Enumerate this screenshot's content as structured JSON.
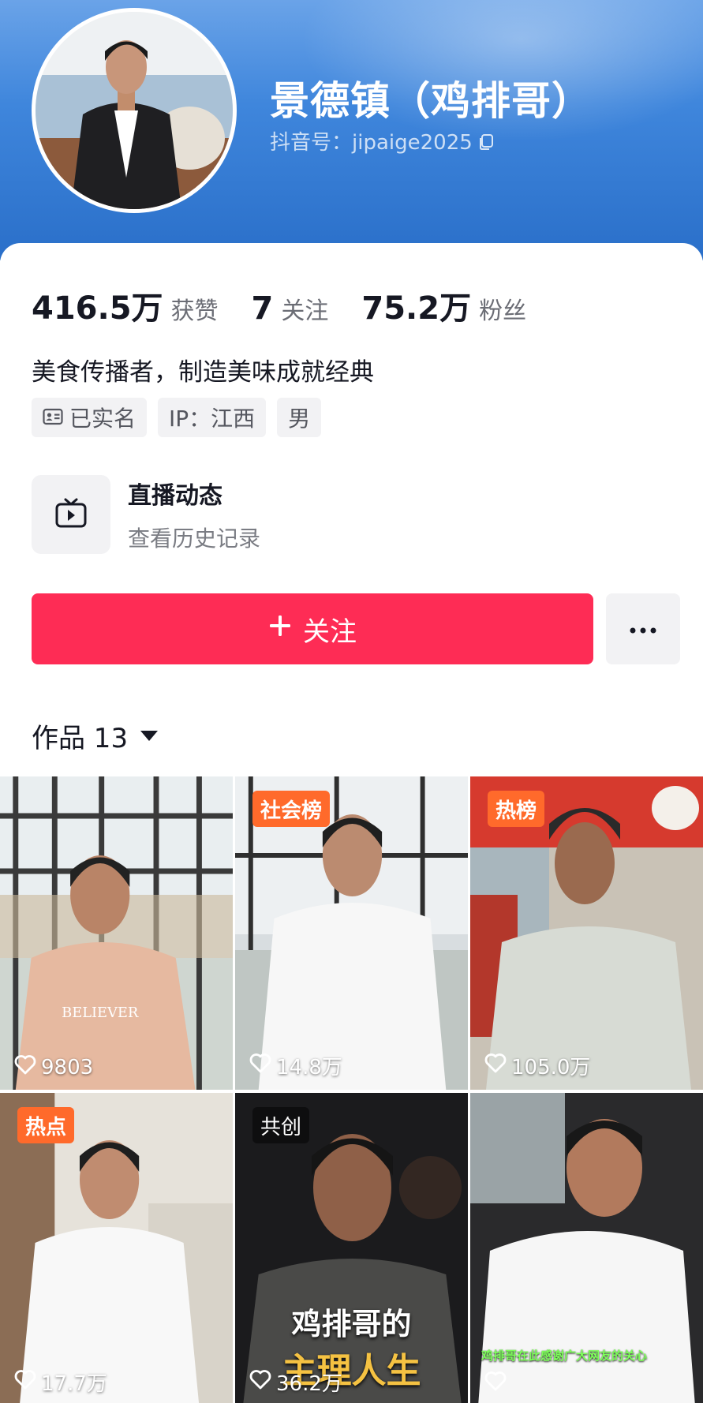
{
  "profile": {
    "nickname": "景德镇（鸡排哥）",
    "douyin_id": "抖音号：jipaige2025",
    "bio": "美食传播者，制造美味成就经典"
  },
  "stats": [
    {
      "value": "416.5万",
      "label": "获赞"
    },
    {
      "value": "7",
      "label": "关注"
    },
    {
      "value": "75.2万",
      "label": "粉丝"
    }
  ],
  "tags": [
    {
      "label": "已实名",
      "icon": "id-card-icon"
    },
    {
      "label": "IP：江西"
    },
    {
      "label": "男"
    }
  ],
  "live": {
    "title": "直播动态",
    "subtitle": "查看历史记录",
    "icon": "tv-icon"
  },
  "actions": {
    "follow_label": "关注",
    "follow_icon": "plus-icon",
    "more_icon": "more-dots-icon"
  },
  "colors": {
    "accent": "#fe2c55",
    "header_blue": "#3f86dc",
    "badge_orange": "#ff6a2b"
  },
  "works": {
    "label": "作品 13",
    "items": [
      {
        "likes": "9803"
      },
      {
        "likes": "14.8万",
        "badge": "社会榜"
      },
      {
        "likes": "105.0万",
        "badge": "热榜"
      },
      {
        "likes": "17.7万",
        "badge": "热点"
      },
      {
        "likes": "36.2万",
        "badge": "共创",
        "title_line1": "鸡排哥的",
        "title_line2": "主理人生"
      },
      {
        "likes": "",
        "caption": "鸡排哥在此感谢广大网友的关心"
      }
    ]
  }
}
